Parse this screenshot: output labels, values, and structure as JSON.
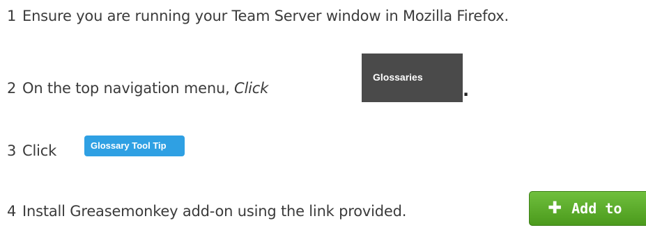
{
  "steps": [
    {
      "number": "1",
      "text": "Ensure you are running your Team Server window in Mozilla Firefox."
    },
    {
      "number": "2",
      "text_before": "On the top navigation menu, ",
      "text_italic": "Click",
      "trailing_period": "."
    },
    {
      "number": "3",
      "text": "Click"
    },
    {
      "number": "4",
      "text": "Install Greasemonkey add-on using the link provided."
    }
  ],
  "buttons": {
    "glossaries": "Glossaries",
    "glossary_tool_tip": "Glossary Tool Tip",
    "add_to": "Add to",
    "add_icon": "plus-icon"
  },
  "colors": {
    "text": "#3b3b3b",
    "glossaries_bg": "#4a4a4a",
    "tooltip_bg": "#2fa0e3",
    "add_bg": "#5aaa28"
  }
}
